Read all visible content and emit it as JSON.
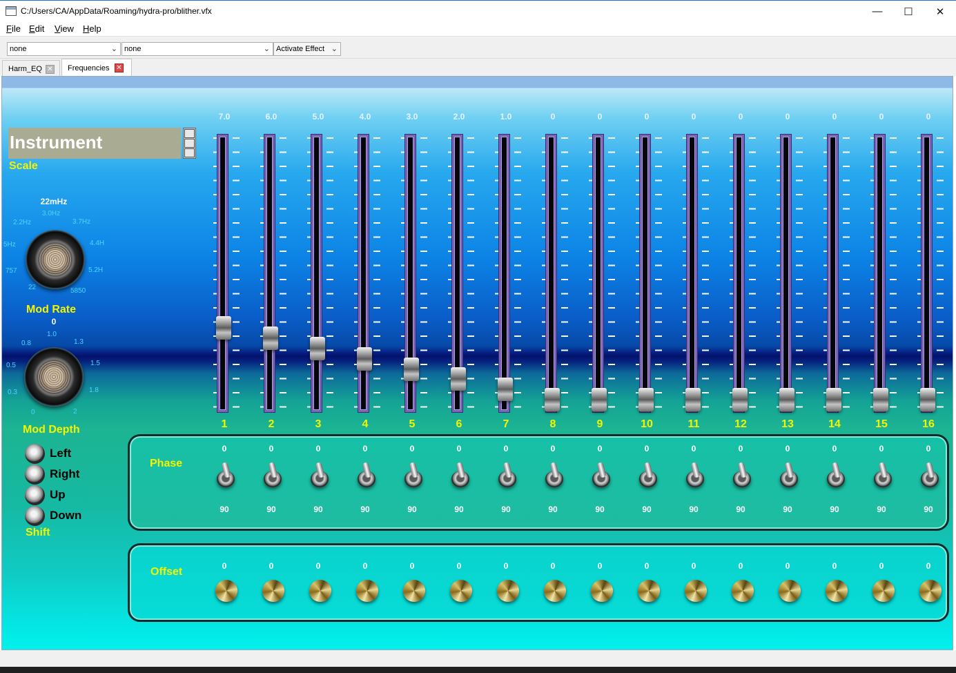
{
  "window": {
    "title": "C:/Users/CA/AppData/Roaming/hydra-pro/blither.vfx",
    "minimize": "—",
    "maximize": "☐",
    "close": "✕"
  },
  "menu": [
    {
      "accel": "F",
      "rest": "ile"
    },
    {
      "accel": "E",
      "rest": "dit"
    },
    {
      "accel": "V",
      "rest": "iew"
    },
    {
      "accel": "H",
      "rest": "elp"
    }
  ],
  "toolbar": {
    "combo1": "none",
    "combo2": "none",
    "effect": "Activate Effect"
  },
  "tabs": [
    {
      "label": "Harm_EQ",
      "active": false
    },
    {
      "label": "Frequencies",
      "active": true
    }
  ],
  "instrument": {
    "label": "Instrument",
    "scale_label": "Scale"
  },
  "mod_rate": {
    "value": "22mHz",
    "label": "Mod Rate",
    "ticks": [
      "22",
      "757",
      "5Hz",
      "2.2Hz",
      "3.0Hz",
      "3.7Hz",
      "4.4H",
      "5.2H",
      "5850"
    ]
  },
  "mod_depth": {
    "value": "0",
    "label": "Mod Depth",
    "ticks": [
      "0",
      "0.3",
      "0.5",
      "0.8",
      "1.0",
      "1.3",
      "1.5",
      "1.8",
      "2"
    ]
  },
  "shift": {
    "label": "Shift",
    "options": [
      "Left",
      "Right",
      "Up",
      "Down"
    ]
  },
  "sliders": {
    "values": [
      "7.0",
      "6.0",
      "5.0",
      "4.0",
      "3.0",
      "2.0",
      "1.0",
      "0",
      "0",
      "0",
      "0",
      "0",
      "0",
      "0",
      "0",
      "0"
    ],
    "levels": [
      7,
      6,
      5,
      4,
      3,
      2,
      1,
      0,
      0,
      0,
      0,
      0,
      0,
      0,
      0,
      0
    ],
    "max": 25,
    "numbers": [
      "1",
      "2",
      "3",
      "4",
      "5",
      "6",
      "7",
      "8",
      "9",
      "10",
      "11",
      "12",
      "13",
      "14",
      "15",
      "16"
    ]
  },
  "phase": {
    "label": "Phase",
    "top_values": [
      "0",
      "0",
      "0",
      "0",
      "0",
      "0",
      "0",
      "0",
      "0",
      "0",
      "0",
      "0",
      "0",
      "0",
      "0",
      "0"
    ],
    "bottom_values": [
      "90",
      "90",
      "90",
      "90",
      "90",
      "90",
      "90",
      "90",
      "90",
      "90",
      "90",
      "90",
      "90",
      "90",
      "90",
      "90"
    ]
  },
  "offset": {
    "label": "Offset",
    "values": [
      "0",
      "0",
      "0",
      "0",
      "0",
      "0",
      "0",
      "0",
      "0",
      "0",
      "0",
      "0",
      "0",
      "0",
      "0",
      "0"
    ]
  },
  "colors": {
    "label_yellow": "#f4f400",
    "tick_cyan": "#4cd6ff",
    "slider_border": "#7864b4"
  }
}
